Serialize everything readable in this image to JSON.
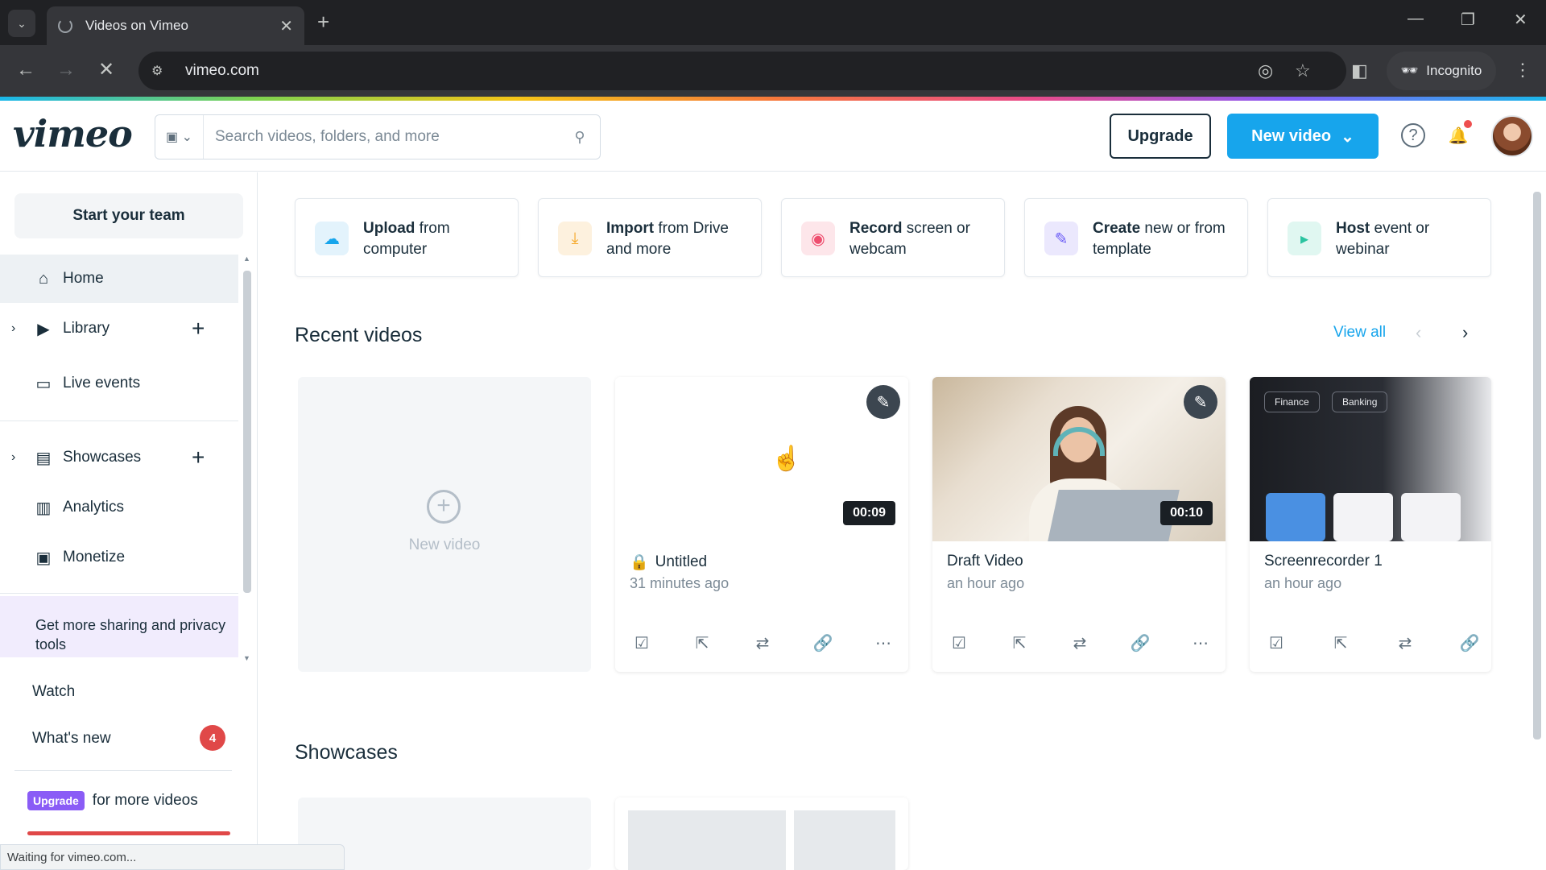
{
  "browser": {
    "tab_title": "Videos on Vimeo",
    "url": "vimeo.com",
    "incognito_label": "Incognito",
    "status_text": "Waiting for vimeo.com..."
  },
  "header": {
    "logo": "vimeo",
    "search_placeholder": "Search videos, folders, and more",
    "upgrade_label": "Upgrade",
    "new_video_label": "New video"
  },
  "sidebar": {
    "start_team": "Start your team",
    "items": [
      {
        "label": "Home",
        "icon": "home-icon"
      },
      {
        "label": "Library",
        "icon": "library-icon"
      },
      {
        "label": "Live events",
        "icon": "camera-icon"
      },
      {
        "label": "Showcases",
        "icon": "showcases-icon"
      },
      {
        "label": "Analytics",
        "icon": "analytics-icon"
      },
      {
        "label": "Monetize",
        "icon": "monetize-icon"
      }
    ],
    "promo_text": "Get more sharing and privacy tools",
    "watch": "Watch",
    "whats_new": "What's new",
    "whats_new_count": "4",
    "upgrade_pill": "Upgrade",
    "upgrade_text": "for more videos"
  },
  "actions": [
    {
      "bold": "Upload",
      "rest": " from computer",
      "color": "#17a5ec",
      "icon": "cloud-upload-icon"
    },
    {
      "bold": "Import",
      "rest": " from Drive and more",
      "color": "#f5a623",
      "icon": "import-icon"
    },
    {
      "bold": "Record",
      "rest": " screen or webcam",
      "color": "#ee4f6f",
      "icon": "record-icon"
    },
    {
      "bold": "Create",
      "rest": " new or from template",
      "color": "#6b5cf6",
      "icon": "create-icon"
    },
    {
      "bold": "Host",
      "rest": " event or webinar",
      "color": "#2bc4a0",
      "icon": "host-icon"
    }
  ],
  "recent": {
    "title": "Recent videos",
    "view_all": "View all",
    "new_video": "New video",
    "videos": [
      {
        "title": "Untitled",
        "time": "31 minutes ago",
        "duration": "00:09",
        "private": true
      },
      {
        "title": "Draft Video",
        "time": "an hour ago",
        "duration": "00:10",
        "private": false
      },
      {
        "title": "Screenrecorder 1",
        "time": "an hour ago",
        "duration": "",
        "private": false
      }
    ],
    "phone_chips": [
      "Finance",
      "Banking"
    ]
  },
  "showcases": {
    "title": "Showcases"
  }
}
